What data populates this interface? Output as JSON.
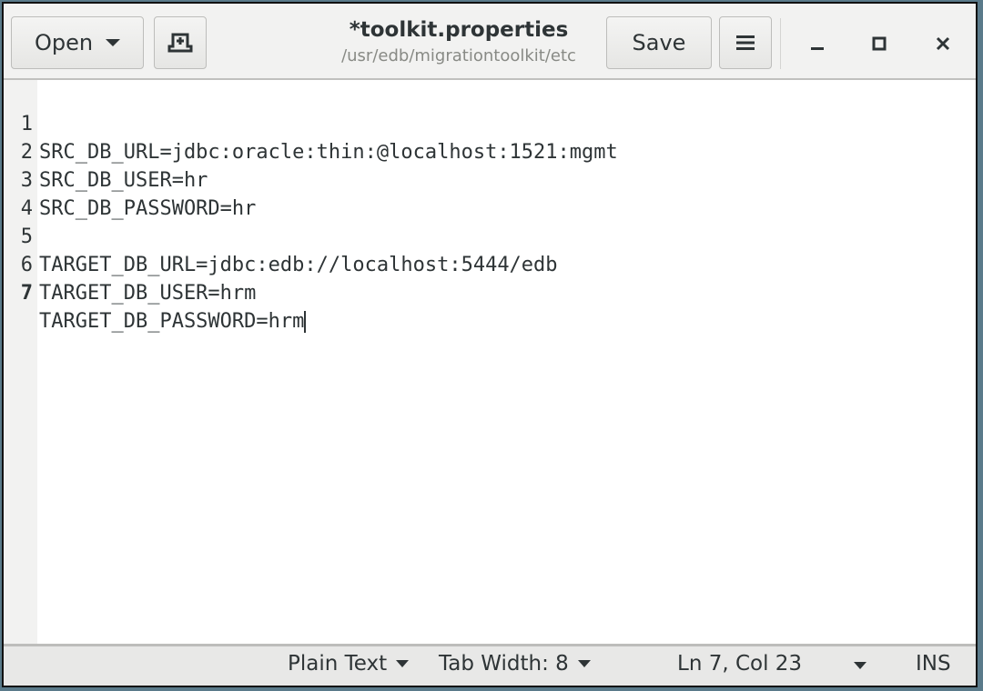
{
  "window": {
    "title": "*toolkit.properties",
    "subtitle": "/usr/edb/migrationtoolkit/etc"
  },
  "toolbar": {
    "open_label": "Open",
    "save_label": "Save"
  },
  "editor": {
    "lines": [
      {
        "num": "1",
        "text": "SRC_DB_URL=jdbc:oracle:thin:@localhost:1521:mgmt"
      },
      {
        "num": "2",
        "text": "SRC_DB_USER=hr"
      },
      {
        "num": "3",
        "text": "SRC_DB_PASSWORD=hr"
      },
      {
        "num": "4",
        "text": ""
      },
      {
        "num": "5",
        "text": "TARGET_DB_URL=jdbc:edb://localhost:5444/edb"
      },
      {
        "num": "6",
        "text": "TARGET_DB_USER=hrm"
      },
      {
        "num": "7",
        "text": "TARGET_DB_PASSWORD=hrm"
      }
    ],
    "current_line": 7
  },
  "statusbar": {
    "language": "Plain Text",
    "tab_width": "Tab Width: 8",
    "position": "Ln 7, Col 23",
    "mode": "INS"
  }
}
